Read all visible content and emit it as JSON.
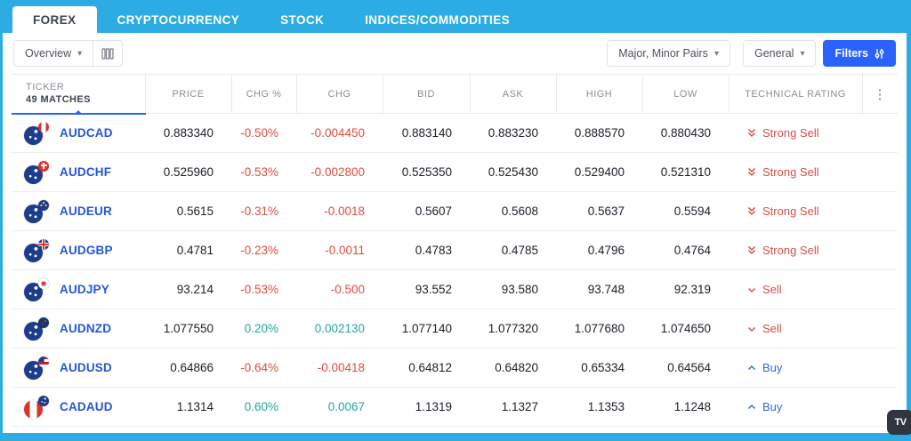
{
  "tabs": {
    "items": [
      {
        "label": "FOREX",
        "active": true
      },
      {
        "label": "CRYPTOCURRENCY",
        "active": false
      },
      {
        "label": "STOCK",
        "active": false
      },
      {
        "label": "INDICES/COMMODITIES",
        "active": false
      }
    ]
  },
  "toolbar": {
    "overview_label": "Overview",
    "pairs_label": "Major, Minor Pairs",
    "general_label": "General",
    "filters_label": "Filters"
  },
  "icons": {
    "dropdown_caret": "▾",
    "menu_dots": "⋮"
  },
  "colors": {
    "accent_cyan": "#2BACE2",
    "accent_blue": "#2962FF",
    "negative_red": "#DE4C42",
    "positive_green": "#26A69A",
    "ticker_link_blue": "#2457D6"
  },
  "table": {
    "ticker_header": {
      "title": "TICKER",
      "matches": "49 MATCHES"
    },
    "columns": [
      "PRICE",
      "CHG %",
      "CHG",
      "BID",
      "ASK",
      "HIGH",
      "LOW",
      "TECHNICAL RATING"
    ],
    "rows": [
      {
        "ticker": "AUDCAD",
        "base": "AUD",
        "quote": "CAD",
        "price": "0.883340",
        "chg_pct": "-0.50%",
        "chg": "-0.004450",
        "bid": "0.883140",
        "ask": "0.883230",
        "high": "0.888570",
        "low": "0.880430",
        "rating": "Strong Sell",
        "rating_dir": "strong_sell"
      },
      {
        "ticker": "AUDCHF",
        "base": "AUD",
        "quote": "CHF",
        "price": "0.525960",
        "chg_pct": "-0.53%",
        "chg": "-0.002800",
        "bid": "0.525350",
        "ask": "0.525430",
        "high": "0.529400",
        "low": "0.521310",
        "rating": "Strong Sell",
        "rating_dir": "strong_sell"
      },
      {
        "ticker": "AUDEUR",
        "base": "AUD",
        "quote": "EUR",
        "price": "0.5615",
        "chg_pct": "-0.31%",
        "chg": "-0.0018",
        "bid": "0.5607",
        "ask": "0.5608",
        "high": "0.5637",
        "low": "0.5594",
        "rating": "Strong Sell",
        "rating_dir": "strong_sell"
      },
      {
        "ticker": "AUDGBP",
        "base": "AUD",
        "quote": "GBP",
        "price": "0.4781",
        "chg_pct": "-0.23%",
        "chg": "-0.0011",
        "bid": "0.4783",
        "ask": "0.4785",
        "high": "0.4796",
        "low": "0.4764",
        "rating": "Strong Sell",
        "rating_dir": "strong_sell"
      },
      {
        "ticker": "AUDJPY",
        "base": "AUD",
        "quote": "JPY",
        "price": "93.214",
        "chg_pct": "-0.53%",
        "chg": "-0.500",
        "bid": "93.552",
        "ask": "93.580",
        "high": "93.748",
        "low": "92.319",
        "rating": "Sell",
        "rating_dir": "sell"
      },
      {
        "ticker": "AUDNZD",
        "base": "AUD",
        "quote": "NZD",
        "price": "1.077550",
        "chg_pct": "0.20%",
        "chg": "0.002130",
        "bid": "1.077140",
        "ask": "1.077320",
        "high": "1.077680",
        "low": "1.074650",
        "rating": "Sell",
        "rating_dir": "sell"
      },
      {
        "ticker": "AUDUSD",
        "base": "AUD",
        "quote": "USD",
        "price": "0.64866",
        "chg_pct": "-0.64%",
        "chg": "-0.00418",
        "bid": "0.64812",
        "ask": "0.64820",
        "high": "0.65334",
        "low": "0.64564",
        "rating": "Buy",
        "rating_dir": "buy"
      },
      {
        "ticker": "CADAUD",
        "base": "CAD",
        "quote": "AUD",
        "price": "1.1314",
        "chg_pct": "0.60%",
        "chg": "0.0067",
        "bid": "1.1319",
        "ask": "1.1327",
        "high": "1.1353",
        "low": "1.1248",
        "rating": "Buy",
        "rating_dir": "buy"
      }
    ]
  },
  "watermark": {
    "logo_text": "TV"
  }
}
